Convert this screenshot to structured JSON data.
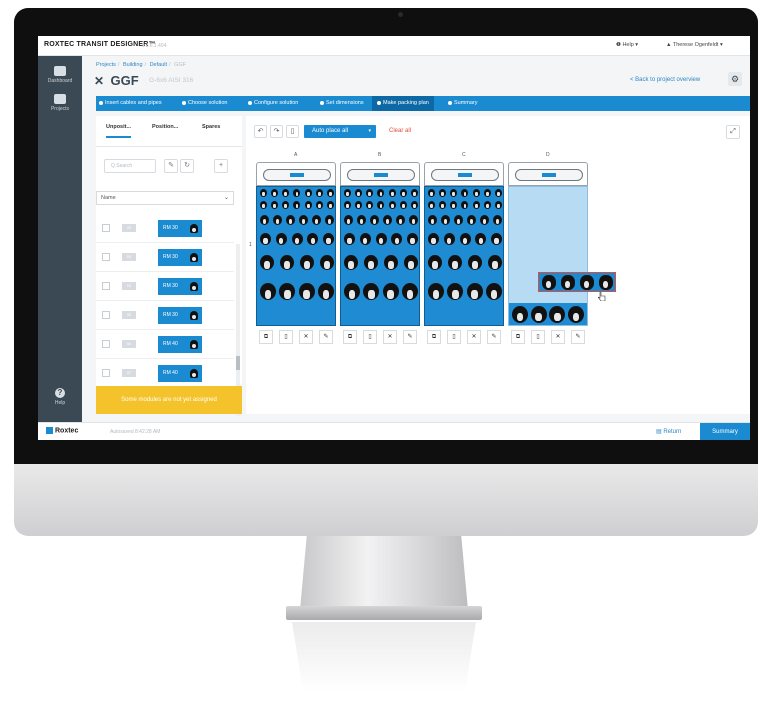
{
  "app": {
    "logo": "ROXTEC TRANSIT DESIGNER™",
    "version": "v.3.6.1.404",
    "help_menu": "❶ Help ▾",
    "user_menu": "▲ Therese Ogenfeldt ▾"
  },
  "nav": {
    "items": [
      {
        "label": "Dashboard",
        "icon": "dashboard-icon"
      },
      {
        "label": "Projects",
        "icon": "projects-icon"
      }
    ],
    "help_label": "Help"
  },
  "breadcrumb": [
    "Projects",
    "Building",
    "Default",
    "GGF"
  ],
  "header": {
    "title": "GGF",
    "subtitle": "G-6x6 AISI 316",
    "back_link": "< Back to project overview"
  },
  "steps": [
    {
      "label": "Insert cables and pipes",
      "active": false
    },
    {
      "label": "Choose solution",
      "active": false
    },
    {
      "label": "Configure solution",
      "active": false
    },
    {
      "label": "Set dimensions",
      "active": false
    },
    {
      "label": "Make packing plan",
      "active": true
    },
    {
      "label": "Summary",
      "active": false
    }
  ],
  "panel": {
    "tabs": [
      "Unposit...",
      "Position...",
      "Spares"
    ],
    "search_placeholder": "Q Search",
    "sort_select": "Name",
    "items": [
      {
        "code": "02",
        "module": "RM 30"
      },
      {
        "code": "03",
        "module": "RM 30"
      },
      {
        "code": "04",
        "module": "RM 30"
      },
      {
        "code": "05",
        "module": "RM 30"
      },
      {
        "code": "06",
        "module": "RM 40"
      },
      {
        "code": "07",
        "module": "RM 40"
      }
    ],
    "warning": "Some modules are not yet assigned"
  },
  "toolbar": {
    "auto_place": "Auto place all",
    "clear_all": "Clear all"
  },
  "frames": {
    "columns": [
      "A",
      "B",
      "C",
      "D"
    ],
    "row_label": "1"
  },
  "footer": {
    "logo": "Roxtec",
    "autosave": "Autosaved 8:42:28 AM",
    "return": "▤ Return",
    "summary": "Summary"
  }
}
